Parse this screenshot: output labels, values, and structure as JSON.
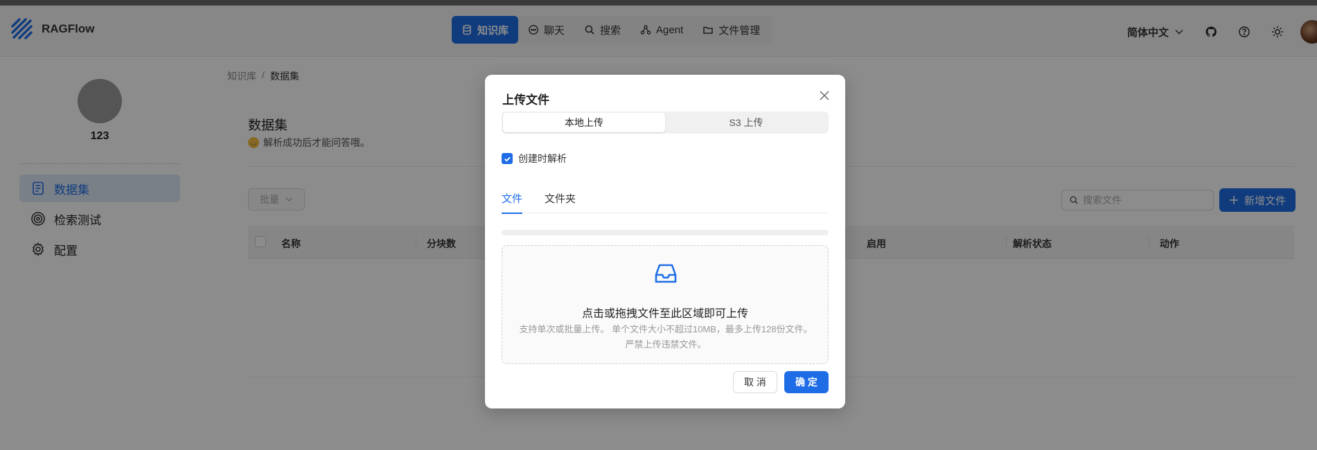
{
  "app": {
    "name": "RAGFlow"
  },
  "nav": {
    "items": [
      {
        "label": "知识库",
        "icon": "database-icon",
        "active": true
      },
      {
        "label": "聊天",
        "icon": "chat-icon"
      },
      {
        "label": "搜索",
        "icon": "search-icon"
      },
      {
        "label": "Agent",
        "icon": "agent-icon"
      },
      {
        "label": "文件管理",
        "icon": "folder-icon"
      }
    ]
  },
  "header": {
    "language": "简体中文"
  },
  "sidebar": {
    "user_name": "123",
    "items": [
      {
        "label": "数据集",
        "icon": "dataset-icon",
        "active": true
      },
      {
        "label": "检索测试",
        "icon": "target-icon"
      },
      {
        "label": "配置",
        "icon": "gear-icon"
      }
    ]
  },
  "breadcrumb": {
    "root": "知识库",
    "separator": "/",
    "current": "数据集"
  },
  "main": {
    "title": "数据集",
    "subtitle": "解析成功后才能问答哦。",
    "batch_label": "批量",
    "search_placeholder": "搜索文件",
    "add_label": "新增文件",
    "columns": [
      "名称",
      "分块数",
      "启用",
      "解析状态",
      "动作"
    ]
  },
  "modal": {
    "title": "上传文件",
    "segments": [
      "本地上传",
      "S3 上传"
    ],
    "parse_on_create_label": "创建时解析",
    "parse_on_create_checked": true,
    "tabs": [
      "文件",
      "文件夹"
    ],
    "progress": 0,
    "dropzone_title": "点击或拖拽文件至此区域即可上传",
    "dropzone_hint": "支持单次或批量上传。 单个文件大小不超过10MB，最多上传128份文件。严禁上传违禁文件。",
    "cancel_label": "取 消",
    "ok_label": "确 定"
  },
  "colors": {
    "primary": "#1e6de6",
    "overlay": "rgba(0,0,0,0.45)"
  }
}
